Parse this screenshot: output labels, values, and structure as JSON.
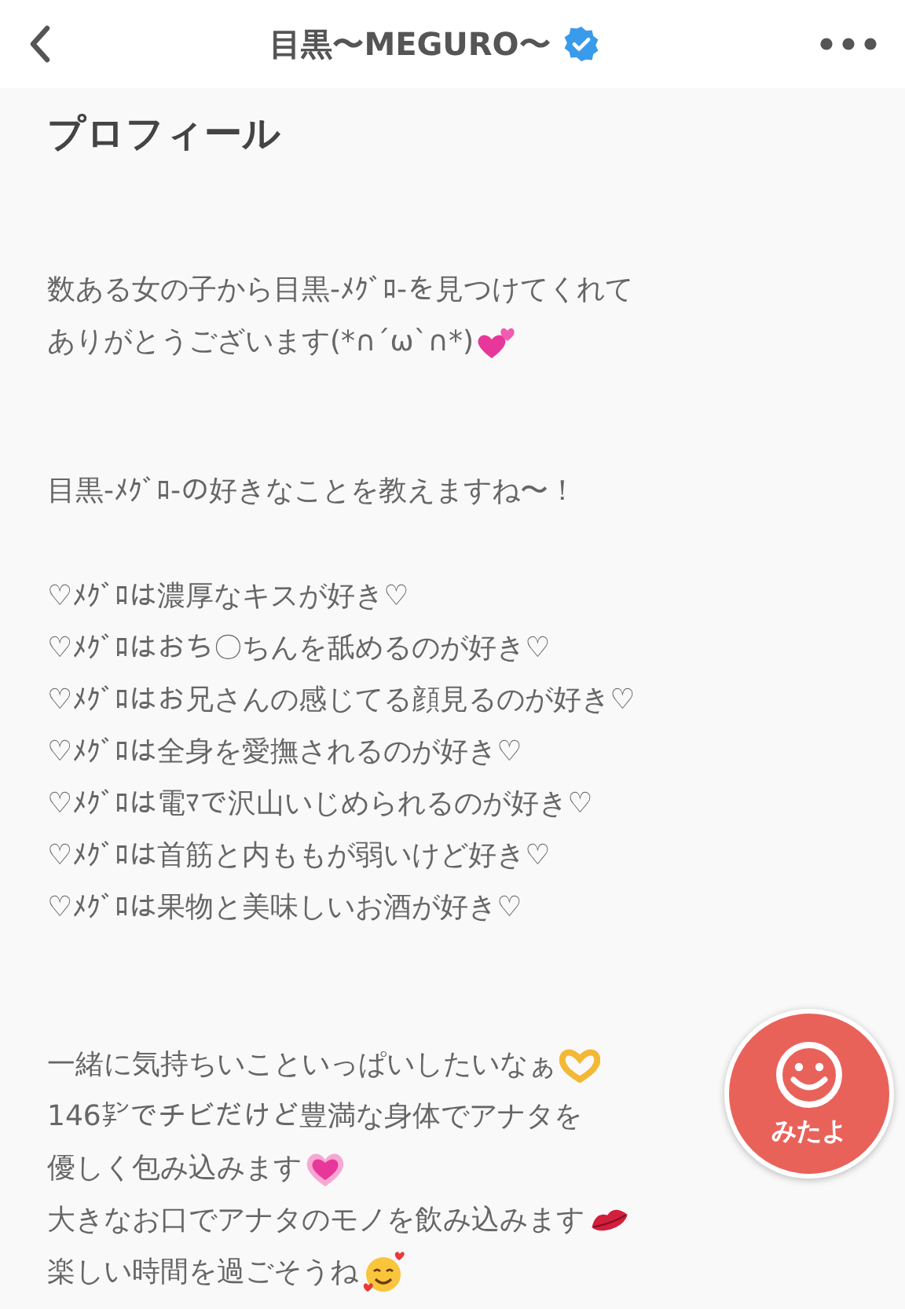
{
  "header": {
    "title": "目黒〜MEGURO〜",
    "verified": true
  },
  "profile": {
    "heading": "プロフィール",
    "blocks": [
      {
        "lines": [
          {
            "kind": "plain",
            "text": "数ある女の子から目黒-ﾒｸﾞﾛ-を見つけてくれて"
          },
          {
            "kind": "two-hearts",
            "text": "ありがとうございます(*∩´ω`∩*)"
          }
        ]
      },
      {
        "lines": [
          {
            "kind": "plain",
            "text": "目黒-ﾒｸﾞﾛ-の好きなことを教えますね〜！"
          }
        ]
      },
      {
        "lines": [
          {
            "kind": "plain",
            "text": "♡ﾒｸﾞﾛは濃厚なキスが好き♡"
          },
          {
            "kind": "plain",
            "text": "♡ﾒｸﾞﾛはおち〇ちんを舐めるのが好き♡"
          },
          {
            "kind": "plain",
            "text": "♡ﾒｸﾞﾛはお兄さんの感じてる顔見るのが好き♡"
          },
          {
            "kind": "plain",
            "text": "♡ﾒｸﾞﾛは全身を愛撫されるのが好き♡"
          },
          {
            "kind": "plain",
            "text": "♡ﾒｸﾞﾛは電ﾏで沢山いじめられるのが好き♡"
          },
          {
            "kind": "plain",
            "text": "♡ﾒｸﾞﾛは首筋と内ももが弱いけど好き♡"
          },
          {
            "kind": "plain",
            "text": "♡ﾒｸﾞﾛは果物と美味しいお酒が好き♡"
          }
        ]
      },
      {
        "lines": [
          {
            "kind": "heart-hands",
            "text": "一緒に気持ちいこといっぱいしたいなぁ"
          },
          {
            "kind": "plain",
            "text": "146㌢でチビだけど豊満な身体でアナタを"
          },
          {
            "kind": "glowing-heart",
            "text": "優しく包み込みます"
          },
          {
            "kind": "kiss-mark",
            "text": "大きなお口でアナタのモノを飲み込みます"
          },
          {
            "kind": "smiling-face-hearts",
            "text": "楽しい時間を過ごそうね"
          }
        ]
      }
    ]
  },
  "float_button": {
    "label": "みたよ"
  }
}
